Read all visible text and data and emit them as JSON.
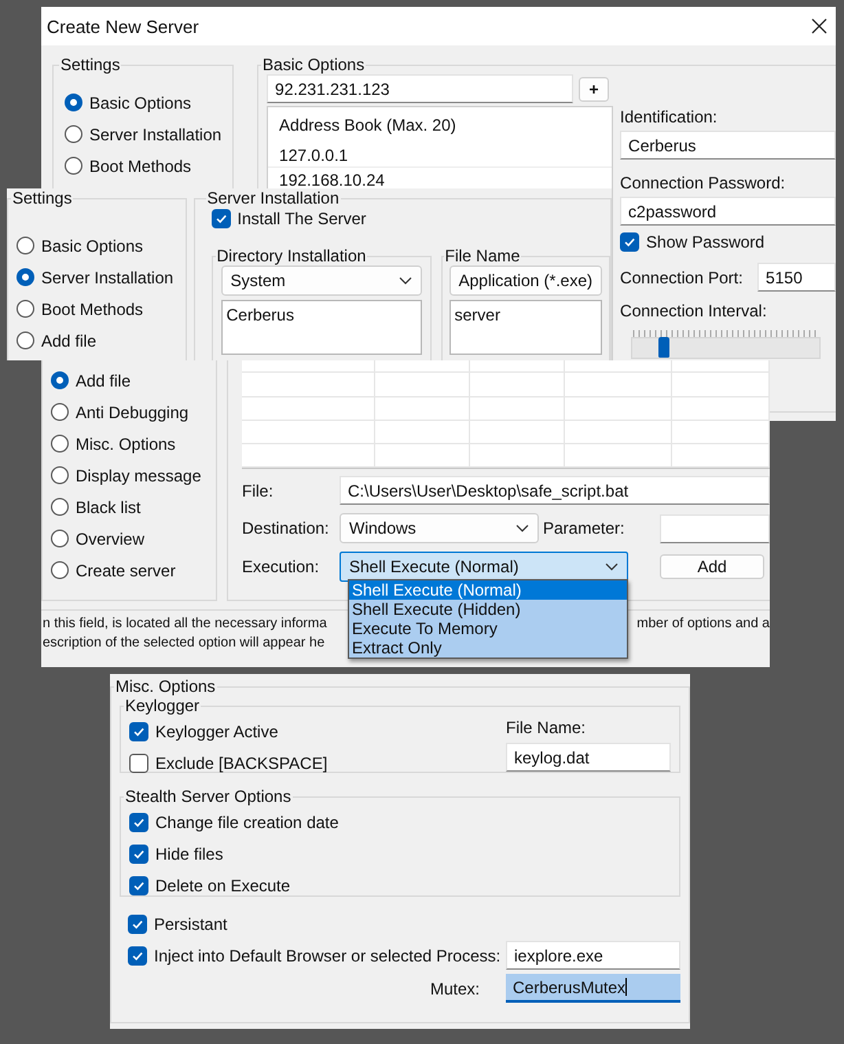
{
  "main_window": {
    "title": "Create New Server",
    "settings": {
      "title": "Settings",
      "options": [
        {
          "label": "Basic Options",
          "selected": true
        },
        {
          "label": "Server Installation",
          "selected": false
        },
        {
          "label": "Boot Methods",
          "selected": false
        }
      ]
    },
    "basic_options": {
      "title": "Basic Options",
      "address": "92.231.231.123",
      "add_button": "+",
      "address_book": {
        "header": "Address Book (Max. 20)",
        "rows": [
          "127.0.0.1",
          "192.168.10.24"
        ]
      },
      "identification": {
        "label": "Identification:",
        "value": "Cerberus"
      },
      "password": {
        "label": "Connection Password:",
        "value": "c2password"
      },
      "show_password": {
        "label": "Show Password",
        "checked": true
      },
      "port": {
        "label": "Connection Port:",
        "value": "5150"
      },
      "interval": {
        "label": "Connection Interval:",
        "level": 0.15
      }
    }
  },
  "installation_window": {
    "settings": {
      "title": "Settings",
      "options": [
        {
          "label": "Basic Options",
          "selected": false
        },
        {
          "label": "Server Installation",
          "selected": true
        },
        {
          "label": "Boot Methods",
          "selected": false
        },
        {
          "label": "Add file",
          "selected": false
        }
      ]
    },
    "server_installation": {
      "title": "Server Installation",
      "install": {
        "label": "Install The Server",
        "checked": true
      },
      "directory": {
        "title": "Directory Installation",
        "choice": "System",
        "value": "Cerberus"
      },
      "file_name": {
        "title": "File Name",
        "choice": "Application (*.exe)",
        "value": "server"
      }
    }
  },
  "add_file_window": {
    "options": [
      {
        "label": "Add file",
        "selected": true
      },
      {
        "label": "Anti Debugging",
        "selected": false
      },
      {
        "label": "Misc. Options",
        "selected": false
      },
      {
        "label": "Display message",
        "selected": false
      },
      {
        "label": "Black list",
        "selected": false
      },
      {
        "label": "Overview",
        "selected": false
      },
      {
        "label": "Create server",
        "selected": false
      }
    ],
    "file": {
      "label": "File:",
      "value": "C:\\Users\\User\\Desktop\\safe_script.bat"
    },
    "destination": {
      "label": "Destination:",
      "choice": "Windows"
    },
    "parameter": {
      "label": "Parameter:"
    },
    "execution": {
      "label": "Execution:",
      "choice": "Shell Execute (Normal)",
      "options": [
        {
          "label": "Shell Execute (Normal)",
          "selected": true
        },
        {
          "label": "Shell Execute (Hidden)",
          "selected": false
        },
        {
          "label": "Execute To Memory",
          "selected": false
        },
        {
          "label": "Extract Only",
          "selected": false
        }
      ]
    },
    "add_button": "Add",
    "description": [
      "n this field, is located all the necessary informa",
      "mber of options and a",
      "escription of the selected option will appear he"
    ]
  },
  "misc_window": {
    "title": "Misc. Options",
    "keylogger": {
      "title": "Keylogger",
      "options": [
        {
          "label": "Keylogger Active",
          "checked": true
        },
        {
          "label": "Exclude [BACKSPACE]",
          "checked": false
        }
      ],
      "file_name": {
        "label": "File Name:",
        "value": "keylog.dat"
      }
    },
    "stealth": {
      "title": "Stealth Server Options",
      "options": [
        {
          "label": "Change file creation date",
          "checked": true
        },
        {
          "label": "Hide files",
          "checked": true
        },
        {
          "label": "Delete on Execute",
          "checked": true
        }
      ]
    },
    "persistant": {
      "label": "Persistant",
      "checked": true
    },
    "inject": {
      "label": "Inject into Default Browser or selected Process:",
      "checked": true,
      "value": "iexplore.exe"
    },
    "mutex": {
      "label": "Mutex:",
      "value": "CerberusMutex"
    }
  }
}
